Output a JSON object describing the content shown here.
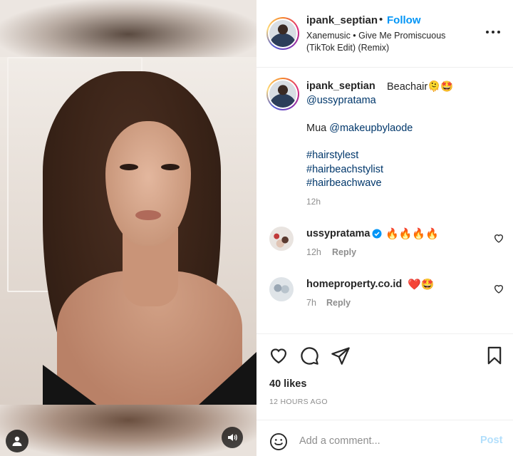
{
  "header": {
    "username": "ipank_septian",
    "separator": "•",
    "follow_label": "Follow",
    "music_line1": "Xanemusic • Give Me Promiscuous",
    "music_line2": "(TikTok Edit) (Remix)"
  },
  "caption": {
    "username": "ipank_septian",
    "text": "Beachair",
    "emojis": "🫠🤩",
    "mention": "@ussypratama",
    "mua_prefix": "Mua ",
    "mua_mention": "@makeupbylaode",
    "hashtags": [
      "#hairstylest",
      "#hairbeachstylist",
      "#hairbeachwave"
    ],
    "time": "12h"
  },
  "comments": [
    {
      "username": "ussypratama",
      "verified": true,
      "text": "🔥🔥🔥🔥",
      "time": "12h",
      "reply_label": "Reply"
    },
    {
      "username": "homeproperty.co.id",
      "verified": false,
      "text": "❤️🤩",
      "time": "7h",
      "reply_label": "Reply"
    }
  ],
  "actions": {
    "likes": "40 likes",
    "time_ago": "12 HOURS AGO",
    "comment_placeholder": "Add a comment...",
    "post_label": "Post"
  },
  "colors": {
    "accent": "#0095f6",
    "link": "#00376b",
    "muted": "#8e8e8e",
    "post_disabled": "#b2dffc",
    "verified": "#0095f6"
  },
  "icons": {
    "media": [
      "user-tag-icon",
      "sound-icon"
    ],
    "header": [
      "more-icon"
    ],
    "actions": [
      "heart-icon",
      "comment-icon",
      "share-icon",
      "bookmark-icon",
      "emoji-icon"
    ]
  }
}
